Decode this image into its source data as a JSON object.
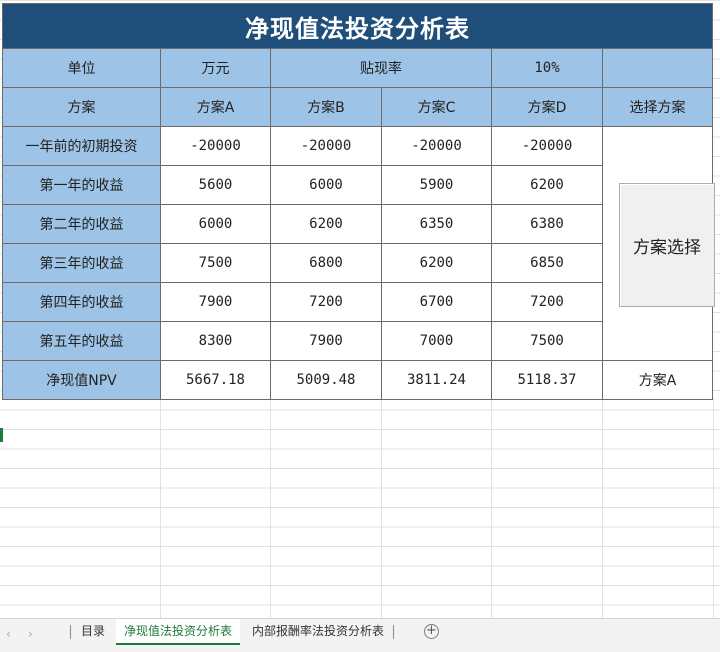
{
  "title": "净现值法投资分析表",
  "header_row": {
    "unit_label": "单位",
    "unit_value": "万元",
    "discount_label": "贴现率",
    "discount_value": "10%"
  },
  "columns": [
    "方案",
    "方案A",
    "方案B",
    "方案C",
    "方案D",
    "选择方案"
  ],
  "rows": [
    {
      "label": "一年前的初期投资",
      "values": [
        "-20000",
        "-20000",
        "-20000",
        "-20000"
      ]
    },
    {
      "label": "第一年的收益",
      "values": [
        "5600",
        "6000",
        "5900",
        "6200"
      ]
    },
    {
      "label": "第二年的收益",
      "values": [
        "6000",
        "6200",
        "6350",
        "6380"
      ]
    },
    {
      "label": "第三年的收益",
      "values": [
        "7500",
        "6800",
        "6200",
        "6850"
      ]
    },
    {
      "label": "第四年的收益",
      "values": [
        "7900",
        "7200",
        "6700",
        "7200"
      ]
    },
    {
      "label": "第五年的收益",
      "values": [
        "8300",
        "7900",
        "7000",
        "7500"
      ]
    }
  ],
  "npv_row": {
    "label": "净现值NPV",
    "values": [
      "5667.18",
      "5009.48",
      "3811.24",
      "5118.37"
    ],
    "choice": "方案A"
  },
  "select_button": "方案选择",
  "tabs": [
    {
      "label": "目录"
    },
    {
      "label": "净现值法投资分析表"
    },
    {
      "label": "内部报酬率法投资分析表"
    }
  ],
  "colors": {
    "title_bg": "#1e4e79",
    "header_bg": "#9dc3e6",
    "active_tab": "#1d7a3d"
  }
}
